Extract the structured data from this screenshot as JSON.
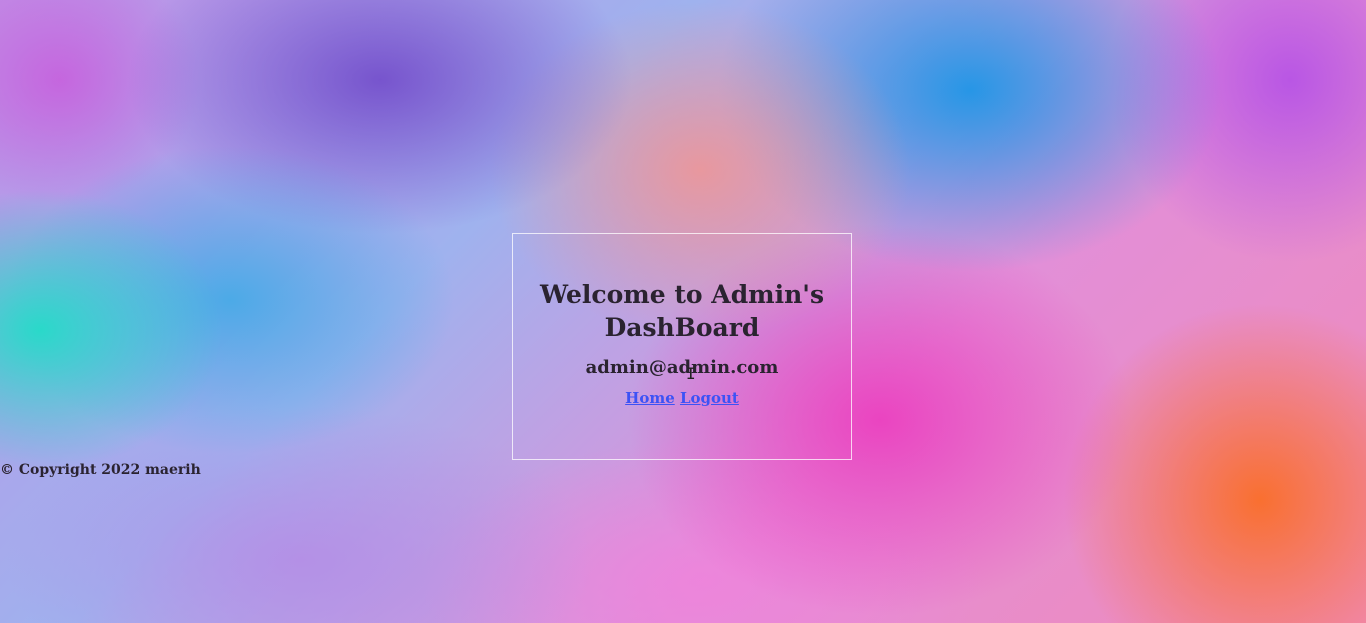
{
  "dashboard": {
    "title": "Welcome to Admin's DashBoard",
    "email": "admin@admin.com",
    "links": {
      "home": "Home",
      "logout": "Logout"
    }
  },
  "footer": {
    "copyright": "© Copyright 2022 maerih"
  },
  "colors": {
    "link": "#3d52f5",
    "text": "#2a2330",
    "card_border": "#ffffff"
  },
  "cursor": {
    "icon": "text-cursor-icon",
    "glyph": "I"
  }
}
